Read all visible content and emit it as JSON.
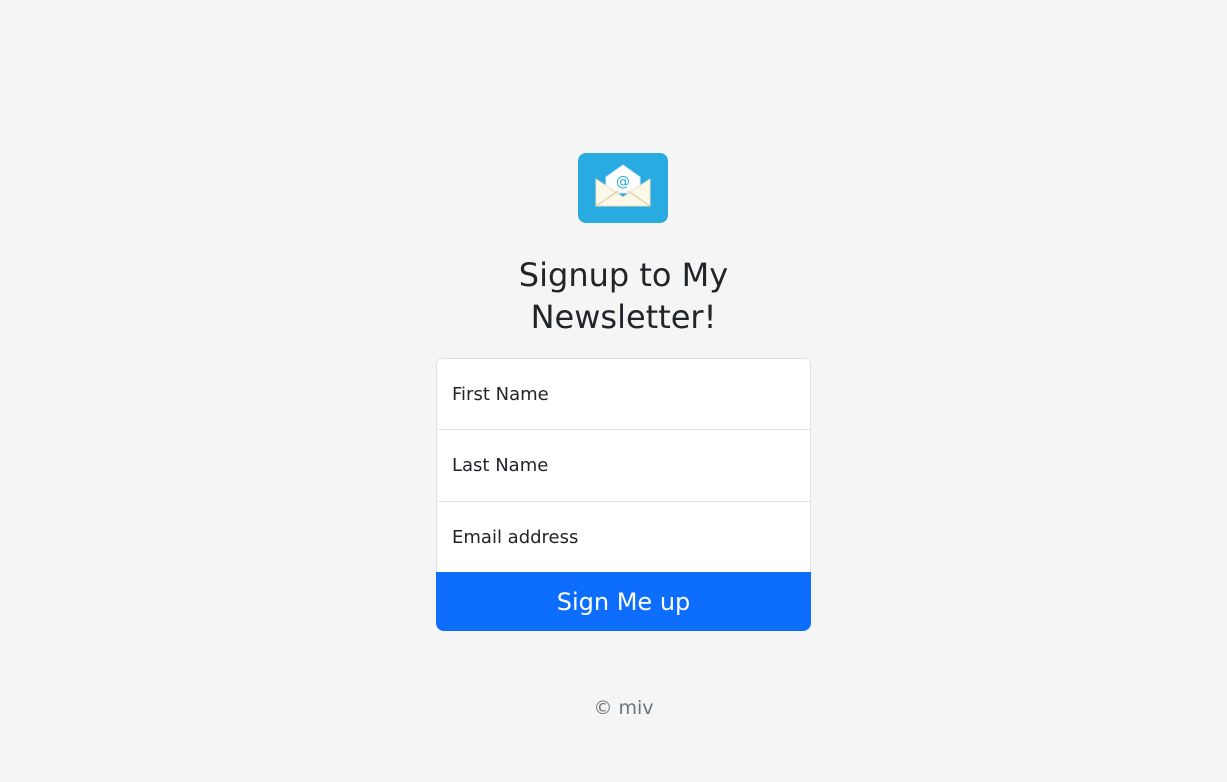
{
  "logo": {
    "icon": "envelope-at-icon",
    "background_color": "#29abe2"
  },
  "heading": {
    "line1": "Signup to My",
    "line2": "Newsletter!"
  },
  "form": {
    "first_name_placeholder": "First Name",
    "last_name_placeholder": "Last Name",
    "email_placeholder": "Email address",
    "submit_label": "Sign Me up",
    "submit_color": "#0d6efd"
  },
  "footer": {
    "text": "© miv"
  }
}
